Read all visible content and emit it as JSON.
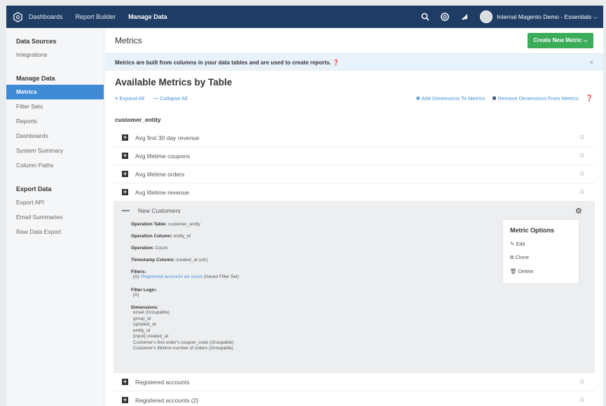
{
  "nav": {
    "links": [
      "Dashboards",
      "Report Builder",
      "Manage Data"
    ],
    "account": "Internal Magento Demo - Essentials ⌵"
  },
  "sidebar": {
    "sections": [
      {
        "title": "Data Sources",
        "items": [
          "Integrations"
        ]
      },
      {
        "title": "Manage Data",
        "items": [
          "Metrics",
          "Filter Sets",
          "Reports",
          "Dashboards",
          "System Summary",
          "Column Paths"
        ]
      },
      {
        "title": "Export Data",
        "items": [
          "Export API",
          "Email Summaries",
          "Raw Data Export"
        ]
      }
    ],
    "active": "Metrics"
  },
  "header": {
    "title": "Metrics",
    "create_button": "Create New Metric ⌵"
  },
  "banner": {
    "text": "Metrics are built from columns in your data tables and are used to create reports. ❓",
    "close": "×"
  },
  "main": {
    "title": "Available Metrics by Table",
    "expand_all": "Expand All",
    "collapse_all": "Collapse All",
    "add_dimensions": "Add Dimensions To Metrics",
    "remove_dimensions": "Remove Dimensions From Metrics",
    "table_name": "customer_entity",
    "metrics_before": [
      "Avg first 30 day revenue",
      "Avg lifetime coupons",
      "Avg lifetime orders",
      "Avg lifetime revenue"
    ],
    "metrics_after": [
      "Registered accounts",
      "Registered accounts (2)"
    ]
  },
  "expanded": {
    "name": "New Customers",
    "operation_table_label": "Operation Table:",
    "operation_table_value": " customer_entity",
    "operation_column_label": "Operation Column:",
    "operation_column_value": " entity_id",
    "operation_label": "Operation:",
    "operation_value": " Count",
    "timestamp_label": "Timestamp Column:",
    "timestamp_value": " created_at (utc)",
    "filters_label": "Filters:",
    "filter_prefix": "[A]: ",
    "filter_link": "Registered accounts we count",
    "filter_suffix": " (Saved Filter Set)",
    "filter_logic_label": "Filter Logic:",
    "filter_logic_value": "[A]",
    "dimensions_label": "Dimensions:",
    "dimensions": [
      "email (Groupable)",
      "group_id",
      "updated_at",
      "entity_id",
      "[input] created_at",
      "Customer's first order's coupon_code (Groupable)",
      "Customer's lifetime number of orders (Groupable)"
    ]
  },
  "options": {
    "title": "Metric Options",
    "edit": "Edit",
    "clone": "Clone",
    "delete": "Delete"
  },
  "colors": {
    "nav": "#1f3c64",
    "accent": "#3f8ad5",
    "create": "#3aac5a",
    "banner": "#e8f2fb"
  }
}
